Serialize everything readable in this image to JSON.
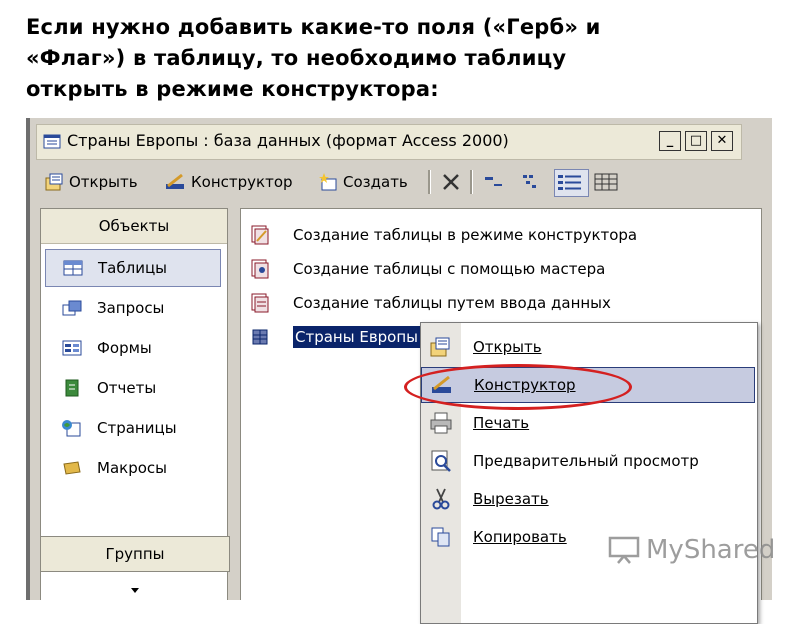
{
  "heading": {
    "line1": "Если нужно добавить какие-то поля («Герб» и",
    "line2": "«Флаг») в таблицу, то необходимо таблицу",
    "line3": "открыть в режиме конструктора:"
  },
  "window": {
    "title": "Страны Европы : база данных (формат Access 2000)",
    "controls": {
      "minimize": "_",
      "maximize": "□",
      "close": "✕"
    }
  },
  "toolbar": {
    "open_label": "Открыть",
    "design_label": "Конструктор",
    "create_label": "Создать"
  },
  "objects_panel": {
    "header": "Объекты",
    "items": [
      {
        "label": "Таблицы",
        "icon": "table-icon",
        "selected": true
      },
      {
        "label": "Запросы",
        "icon": "query-icon"
      },
      {
        "label": "Формы",
        "icon": "form-icon"
      },
      {
        "label": "Отчеты",
        "icon": "report-icon"
      },
      {
        "label": "Страницы",
        "icon": "page-icon"
      },
      {
        "label": "Макросы",
        "icon": "macro-icon"
      }
    ],
    "groups_label": "Группы"
  },
  "list_panel": {
    "items": [
      {
        "label": "Создание таблицы в режиме конструктора",
        "icon": "design-wizard-icon"
      },
      {
        "label": "Создание таблицы с помощью мастера",
        "icon": "wizard-icon"
      },
      {
        "label": "Создание таблицы путем ввода данных",
        "icon": "data-entry-icon"
      },
      {
        "label": "Страны Европы",
        "icon": "table-icon",
        "selected": true
      }
    ]
  },
  "context_menu": {
    "items": [
      {
        "label": "Открыть",
        "icon": "open-icon"
      },
      {
        "label": "Конструктор",
        "icon": "design-icon",
        "highlighted": true
      },
      {
        "label": "Печать",
        "icon": "print-icon"
      },
      {
        "label": "Предварительный просмотр",
        "icon": "preview-icon"
      },
      {
        "label": "Вырезать",
        "icon": "cut-icon"
      },
      {
        "label": "Копировать",
        "icon": "copy-icon"
      }
    ]
  },
  "watermark": {
    "text": "MyShared"
  },
  "colors": {
    "selection_blue": "#0a246a",
    "menu_highlight": "#c6cbe0",
    "annotation_red": "#d42020"
  }
}
